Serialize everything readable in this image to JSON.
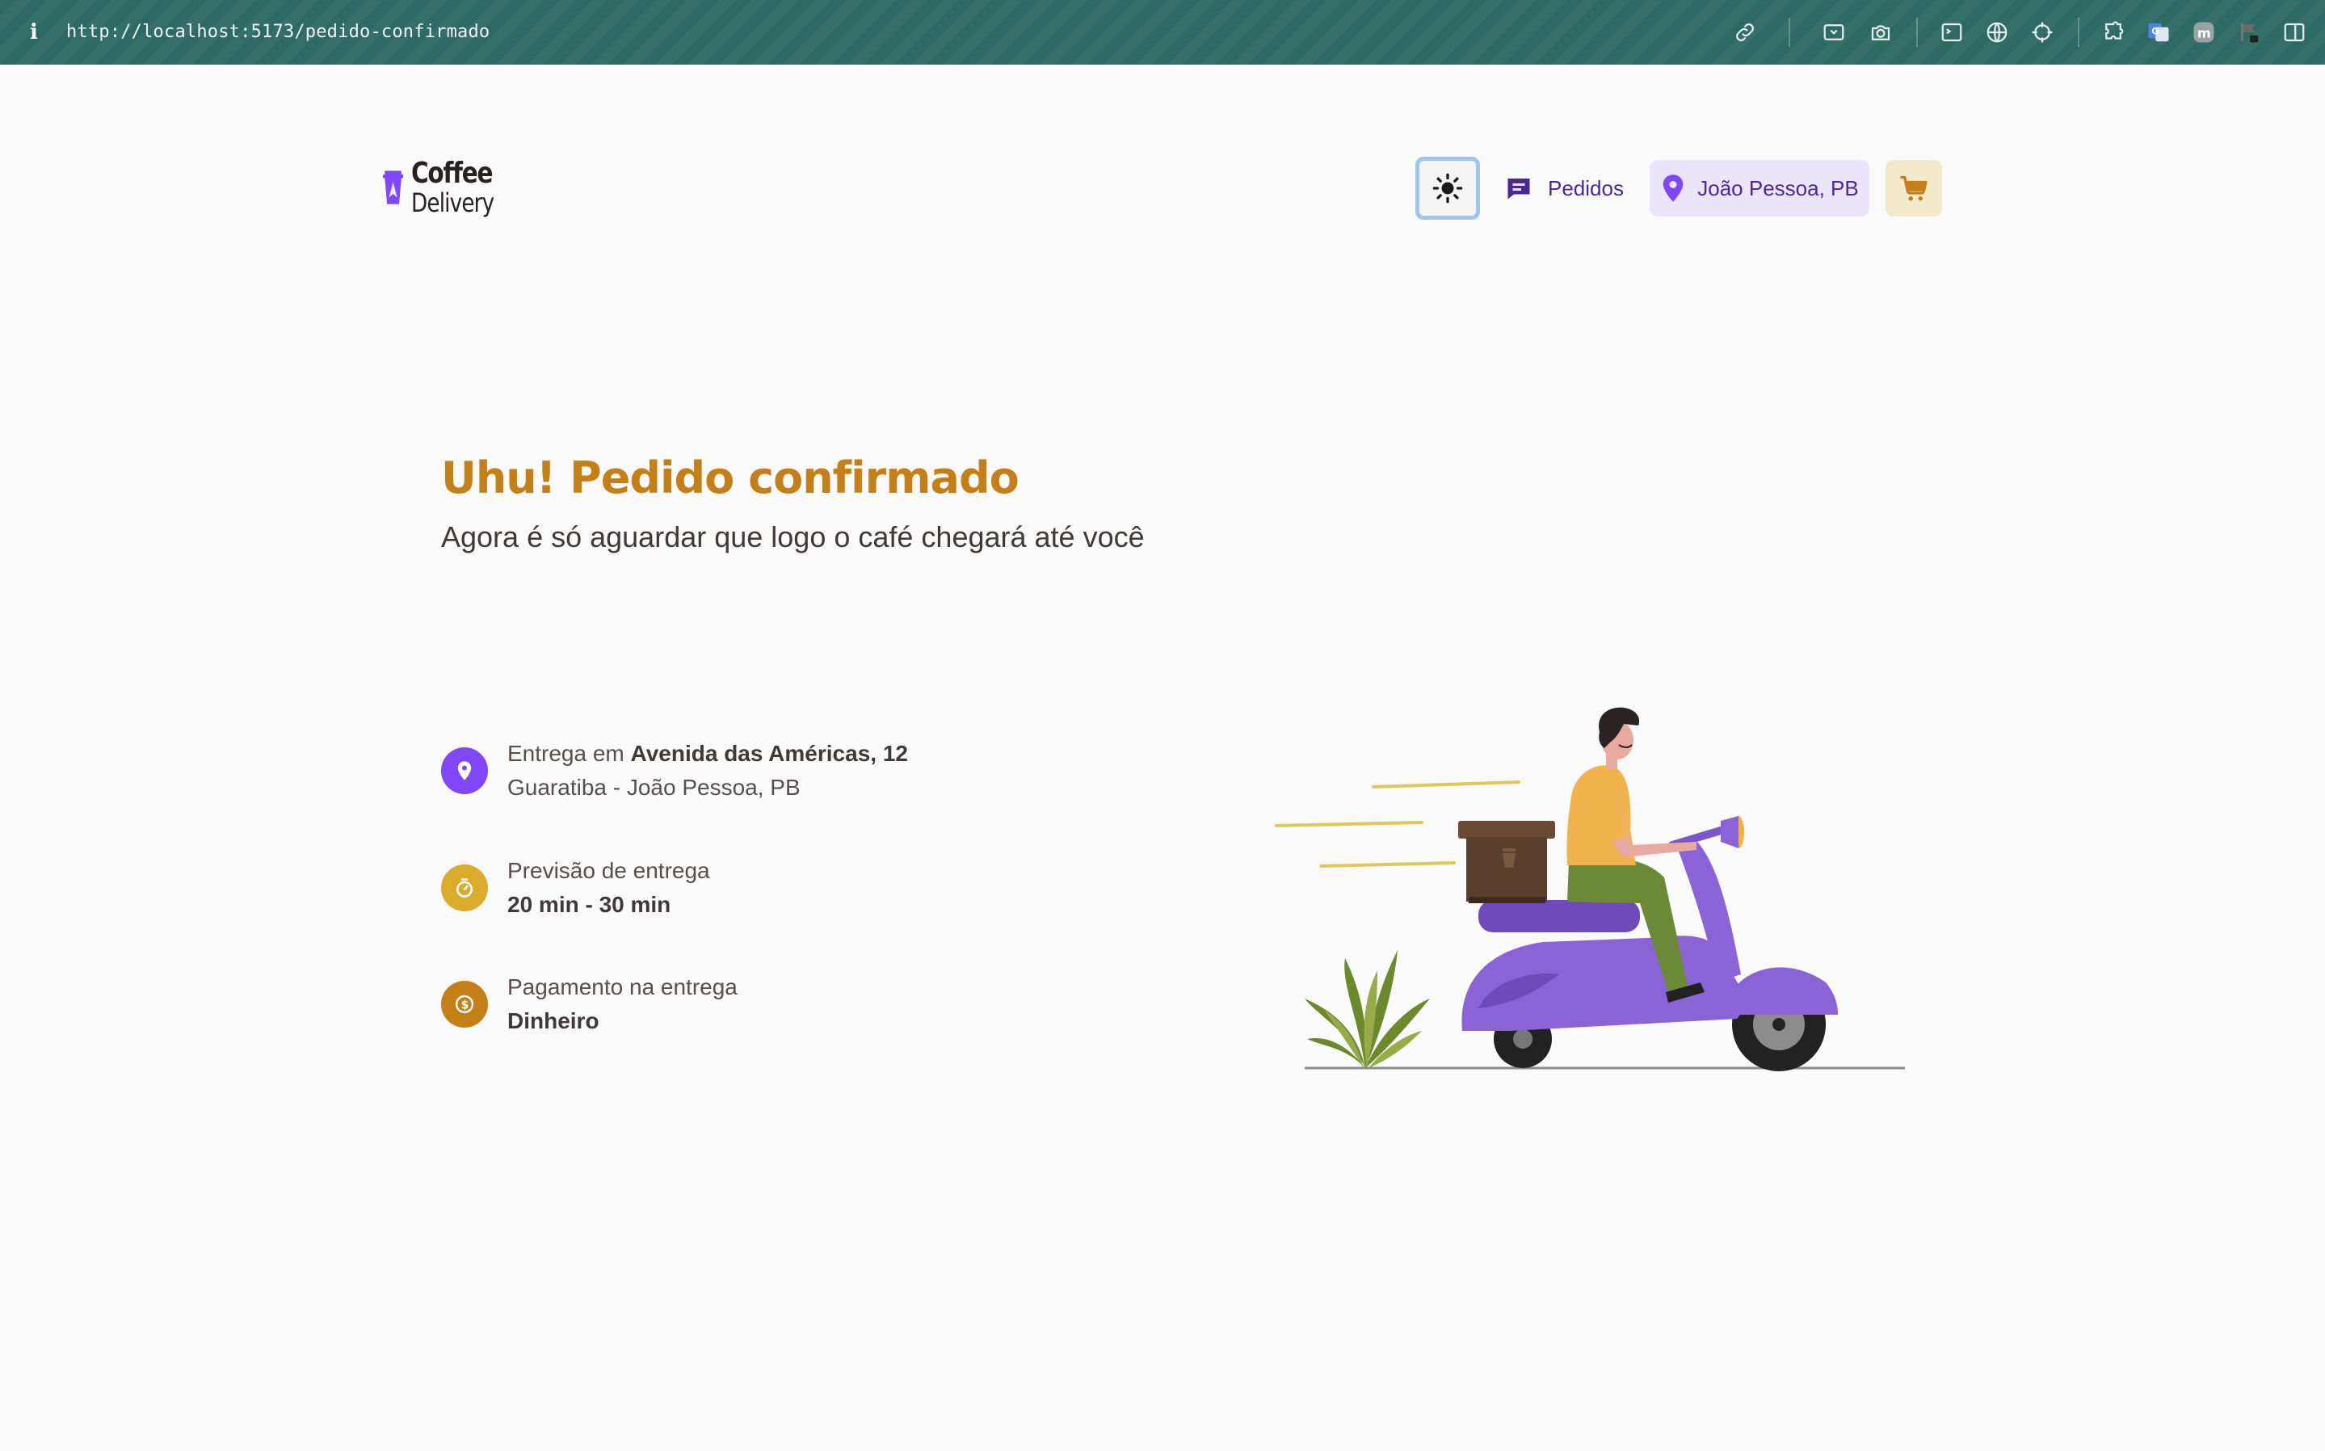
{
  "browser": {
    "url": "http://localhost:5173/pedido-confirmado",
    "info_glyph": "i",
    "toolbar_icons": [
      "link-icon",
      "screenshot-icon",
      "camera-icon",
      "terminal-icon",
      "globe-icon",
      "crosshair-icon",
      "extensions-icon",
      "translate-icon",
      "m-extension-icon",
      "flag-extension-icon",
      "sidebar-icon"
    ],
    "bar_color": "#2d6a63"
  },
  "header": {
    "logo": {
      "line1": "Coffee",
      "line2": "Delivery"
    },
    "theme_toggle_icon": "sun-icon",
    "orders_label": "Pedidos",
    "location_label": "João Pessoa, PB",
    "cart_icon": "cart-icon"
  },
  "hero": {
    "title": "Uhu! Pedido confirmado",
    "subtitle": "Agora é só aguardar que logo o café chegará até você"
  },
  "delivery_info": {
    "address": {
      "prefix": "Entrega em ",
      "street": "Avenida das Américas, 12",
      "line2": "Guaratiba - João Pessoa, PB",
      "icon": "map-pin-icon",
      "color": "#8047f8"
    },
    "forecast": {
      "label": "Previsão de entrega",
      "value": "20 min - 30 min",
      "icon": "timer-icon",
      "color": "#dbac2c"
    },
    "payment": {
      "label": "Pagamento na entrega",
      "value": "Dinheiro",
      "icon": "dollar-icon",
      "color": "#c47f17"
    }
  },
  "colors": {
    "purple": "#8047f8",
    "purple_dark": "#4b2995",
    "purple_light": "#ebe5f9",
    "yellow_dark": "#c47f17",
    "yellow": "#dbac2c",
    "yellow_light": "#f1e9c9"
  }
}
